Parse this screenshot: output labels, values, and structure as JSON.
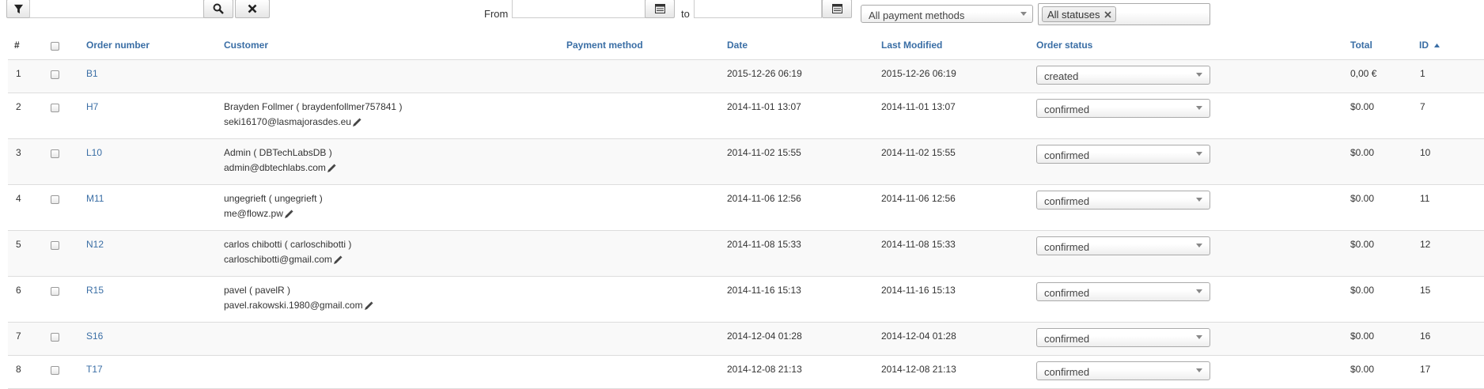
{
  "toolbar": {
    "filter_icon": "filter-icon",
    "search_icon": "search-icon",
    "clear_icon": "close-icon",
    "search_value": "",
    "from_label": "From",
    "to_label": "to",
    "from_value": "",
    "to_value": "",
    "calendar_icon": "calendar-icon",
    "payment_filter": "All payment methods",
    "status_chip": "All statuses",
    "chip_remove_icon": "close-icon"
  },
  "table": {
    "headers": {
      "num": "#",
      "order_number": "Order number",
      "customer": "Customer",
      "payment_method": "Payment method",
      "date": "Date",
      "last_modified": "Last Modified",
      "order_status": "Order status",
      "total": "Total",
      "id": "ID"
    },
    "sort_icon": "sort-ascending-icon",
    "edit_icon": "pencil-icon",
    "rows": [
      {
        "num": "1",
        "order": "B1",
        "customer_name": "",
        "customer_email": "",
        "payment": "",
        "date": "2015-12-26 06:19",
        "modified": "2015-12-26 06:19",
        "status": "created",
        "total": "0,00 €",
        "id": "1"
      },
      {
        "num": "2",
        "order": "H7",
        "customer_name": "Brayden Follmer ( braydenfollmer757841 )",
        "customer_email": "seki16170@lasmajorasdes.eu",
        "payment": "",
        "date": "2014-11-01 13:07",
        "modified": "2014-11-01 13:07",
        "status": "confirmed",
        "total": "$0.00",
        "id": "7"
      },
      {
        "num": "3",
        "order": "L10",
        "customer_name": "Admin ( DBTechLabsDB )",
        "customer_email": "admin@dbtechlabs.com",
        "payment": "",
        "date": "2014-11-02 15:55",
        "modified": "2014-11-02 15:55",
        "status": "confirmed",
        "total": "$0.00",
        "id": "10"
      },
      {
        "num": "4",
        "order": "M11",
        "customer_name": "ungegrieft ( ungegrieft )",
        "customer_email": "me@flowz.pw",
        "payment": "",
        "date": "2014-11-06 12:56",
        "modified": "2014-11-06 12:56",
        "status": "confirmed",
        "total": "$0.00",
        "id": "11"
      },
      {
        "num": "5",
        "order": "N12",
        "customer_name": "carlos chibotti ( carloschibotti )",
        "customer_email": "carloschibotti@gmail.com",
        "payment": "",
        "date": "2014-11-08 15:33",
        "modified": "2014-11-08 15:33",
        "status": "confirmed",
        "total": "$0.00",
        "id": "12"
      },
      {
        "num": "6",
        "order": "R15",
        "customer_name": "pavel ( pavelR )",
        "customer_email": "pavel.rakowski.1980@gmail.com",
        "payment": "",
        "date": "2014-11-16 15:13",
        "modified": "2014-11-16 15:13",
        "status": "confirmed",
        "total": "$0.00",
        "id": "15"
      },
      {
        "num": "7",
        "order": "S16",
        "customer_name": "",
        "customer_email": "",
        "payment": "",
        "date": "2014-12-04 01:28",
        "modified": "2014-12-04 01:28",
        "status": "confirmed",
        "total": "$0.00",
        "id": "16"
      },
      {
        "num": "8",
        "order": "T17",
        "customer_name": "",
        "customer_email": "",
        "payment": "",
        "date": "2014-12-08 21:13",
        "modified": "2014-12-08 21:13",
        "status": "confirmed",
        "total": "$0.00",
        "id": "17"
      }
    ]
  },
  "colors": {
    "link": "#3a6ea5",
    "row_alt": "#f9f9f9",
    "border": "#dddddd"
  }
}
